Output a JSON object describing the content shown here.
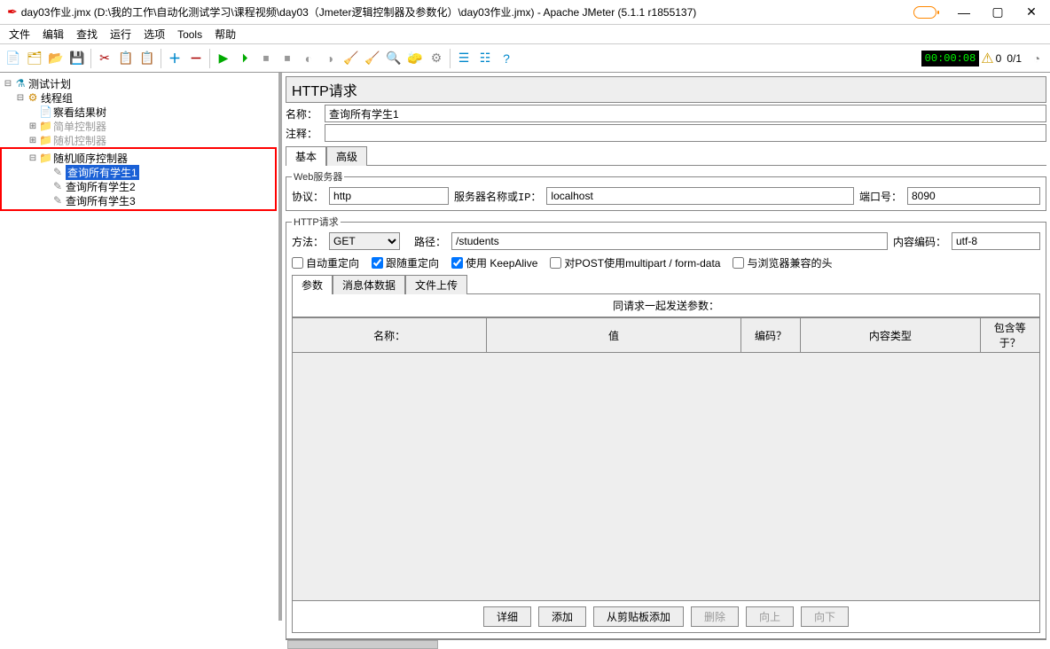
{
  "window": {
    "title": "day03作业.jmx (D:\\我的工作\\自动化测试学习\\课程视频\\day03（Jmeter逻辑控制器及参数化）\\day03作业.jmx) - Apache JMeter (5.1.1 r1855137)"
  },
  "menu": {
    "items": [
      "文件",
      "编辑",
      "查找",
      "运行",
      "选项",
      "Tools",
      "帮助"
    ]
  },
  "toolbar": {
    "icons": [
      "new-file-icon",
      "template-icon",
      "open-icon",
      "save-icon",
      "cut-icon",
      "copy-icon",
      "paste-icon",
      "add-icon",
      "remove-icon",
      "run-icon",
      "run-no-pause-icon",
      "stop-icon",
      "shutdown-icon",
      "toggle-icon",
      "clear-icon",
      "clear-all-icon",
      "search-icon",
      "function-icon",
      "help-icon",
      "sep",
      "expand-icon",
      "collapse-icon",
      "expand-all-icon"
    ],
    "elapsed": "00:00:08",
    "threads": "0/1"
  },
  "tree": {
    "root": "测试计划",
    "thread_group": "线程组",
    "view_results": "察看结果树",
    "simple_ctrl": "简单控制器",
    "random_ctrl": "随机控制器",
    "random_order_ctrl": "随机顺序控制器",
    "samplers": [
      "查询所有学生1",
      "查询所有学生2",
      "查询所有学生3"
    ]
  },
  "http": {
    "panel_title": "HTTP请求",
    "name_label": "名称：",
    "name_value": "查询所有学生1",
    "comment_label": "注释：",
    "tab_basic": "基本",
    "tab_advanced": "高级",
    "web_legend": "Web服务器",
    "protocol_label": "协议：",
    "protocol_value": "http",
    "server_label": "服务器名称或IP：",
    "server_value": "localhost",
    "port_label": "端口号：",
    "port_value": "8090",
    "req_legend": "HTTP请求",
    "method_label": "方法：",
    "method_value": "GET",
    "path_label": "路径：",
    "path_value": "/students",
    "enc_label": "内容编码：",
    "enc_value": "utf-8",
    "chk_auto": "自动重定向",
    "chk_follow": "跟随重定向",
    "chk_keepalive": "使用 KeepAlive",
    "chk_multipart": "对POST使用multipart / form-data",
    "chk_browser": "与浏览器兼容的头",
    "subtab_params": "参数",
    "subtab_body": "消息体数据",
    "subtab_upload": "文件上传",
    "params_caption": "同请求一起发送参数：",
    "cols": {
      "name": "名称：",
      "value": "值",
      "encode": "编码？",
      "ctype": "内容类型",
      "include": "包含等于？"
    },
    "btns": {
      "detail": "详细",
      "add": "添加",
      "clip": "从剪贴板添加",
      "del": "删除",
      "up": "向上",
      "down": "向下"
    }
  },
  "status": {
    "warn_count": "0"
  }
}
